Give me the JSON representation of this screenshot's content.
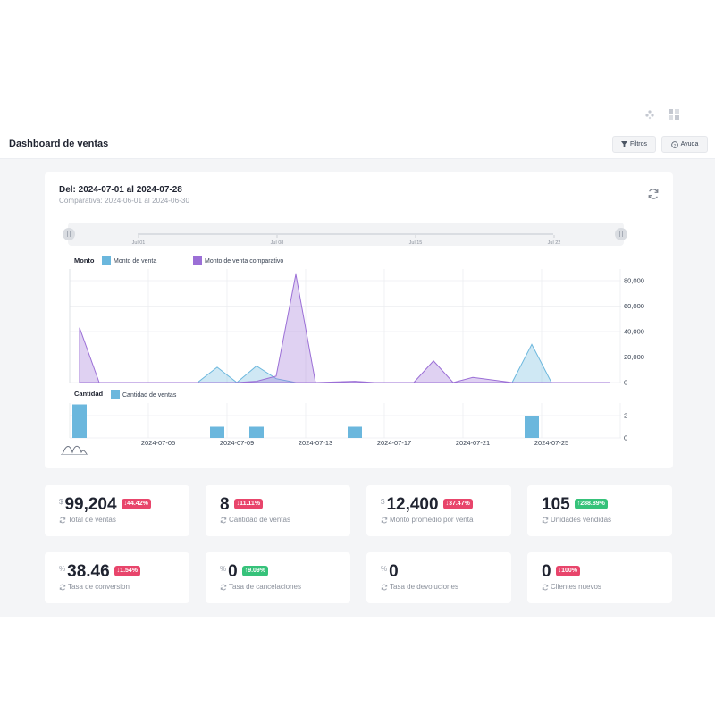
{
  "header": {
    "title": "Dashboard de ventas",
    "filters_label": "Filtros",
    "help_label": "Ayuda"
  },
  "summary": {
    "range_label": "Del: 2024-07-01 al 2024-07-28",
    "comparison_label": "Comparativa: 2024-06-01 al 2024-06-30"
  },
  "colors": {
    "sales": "#6bb7dd",
    "sales_comparative": "#9b6fd6",
    "badge_down": "#e8456b",
    "badge_up": "#36c27a"
  },
  "chart_data": [
    {
      "type": "area",
      "title": "Monto",
      "legend": [
        "Monto de venta",
        "Monto de venta comparativo"
      ],
      "x_ticks": [
        "2024-07-05",
        "2024-07-09",
        "2024-07-13",
        "2024-07-17",
        "2024-07-21",
        "2024-07-25"
      ],
      "y_ticks": [
        "0",
        "20,000",
        "40,000",
        "60,000",
        "80,000"
      ],
      "ylim": [
        0,
        90000
      ],
      "navigator_ticks": [
        "Jul 01",
        "Jul 08",
        "Jul 15",
        "Jul 22"
      ],
      "series": [
        {
          "name": "Monto de venta",
          "points": [
            [
              "2024-07-01",
              0
            ],
            [
              "2024-07-02",
              0
            ],
            [
              "2024-07-05",
              0
            ],
            [
              "2024-07-07",
              0
            ],
            [
              "2024-07-08",
              12000
            ],
            [
              "2024-07-09",
              0
            ],
            [
              "2024-07-10",
              13000
            ],
            [
              "2024-07-11",
              3000
            ],
            [
              "2024-07-12",
              0
            ],
            [
              "2024-07-15",
              0
            ],
            [
              "2024-07-17",
              0
            ],
            [
              "2024-07-19",
              0
            ],
            [
              "2024-07-23",
              0
            ],
            [
              "2024-07-24",
              30000
            ],
            [
              "2024-07-25",
              0
            ],
            [
              "2024-07-28",
              0
            ]
          ]
        },
        {
          "name": "Monto de venta comparativo",
          "points": [
            [
              "2024-07-01",
              43000
            ],
            [
              "2024-07-02",
              0
            ],
            [
              "2024-07-09",
              0
            ],
            [
              "2024-07-10",
              1000
            ],
            [
              "2024-07-11",
              5000
            ],
            [
              "2024-07-12",
              85000
            ],
            [
              "2024-07-13",
              0
            ],
            [
              "2024-07-15",
              1000
            ],
            [
              "2024-07-16",
              0
            ],
            [
              "2024-07-18",
              0
            ],
            [
              "2024-07-19",
              17000
            ],
            [
              "2024-07-20",
              0
            ],
            [
              "2024-07-21",
              4000
            ],
            [
              "2024-07-23",
              0
            ],
            [
              "2024-07-28",
              0
            ]
          ]
        }
      ]
    },
    {
      "type": "bar",
      "title": "Cantidad",
      "legend": [
        "Cantidad de ventas"
      ],
      "y_ticks": [
        "0",
        "2"
      ],
      "ylim": [
        0,
        3
      ],
      "series": [
        {
          "name": "Cantidad de ventas",
          "points": [
            [
              "2024-07-01",
              3
            ],
            [
              "2024-07-08",
              1
            ],
            [
              "2024-07-10",
              1
            ],
            [
              "2024-07-15",
              1
            ],
            [
              "2024-07-24",
              2
            ]
          ]
        }
      ]
    }
  ],
  "kpis": [
    {
      "prefix": "$",
      "value": "99,204",
      "change": "44.42%",
      "direction": "down",
      "label": "Total de ventas"
    },
    {
      "prefix": "",
      "value": "8",
      "change": "11.11%",
      "direction": "down",
      "label": "Cantidad de ventas"
    },
    {
      "prefix": "$",
      "value": "12,400",
      "change": "37.47%",
      "direction": "down",
      "label": "Monto promedio por venta"
    },
    {
      "prefix": "",
      "value": "105",
      "change": "288.89%",
      "direction": "up",
      "label": "Unidades vendidas"
    },
    {
      "prefix": "%",
      "value": "38.46",
      "change": "1.54%",
      "direction": "down",
      "label": "Tasa de conversion"
    },
    {
      "prefix": "%",
      "value": "0",
      "change": "9.09%",
      "direction": "up",
      "label": "Tasa de cancelaciones"
    },
    {
      "prefix": "%",
      "value": "0",
      "change": "",
      "direction": "",
      "label": "Tasa de devoluciones"
    },
    {
      "prefix": "",
      "value": "0",
      "change": "100%",
      "direction": "down",
      "label": "Clientes nuevos"
    }
  ]
}
